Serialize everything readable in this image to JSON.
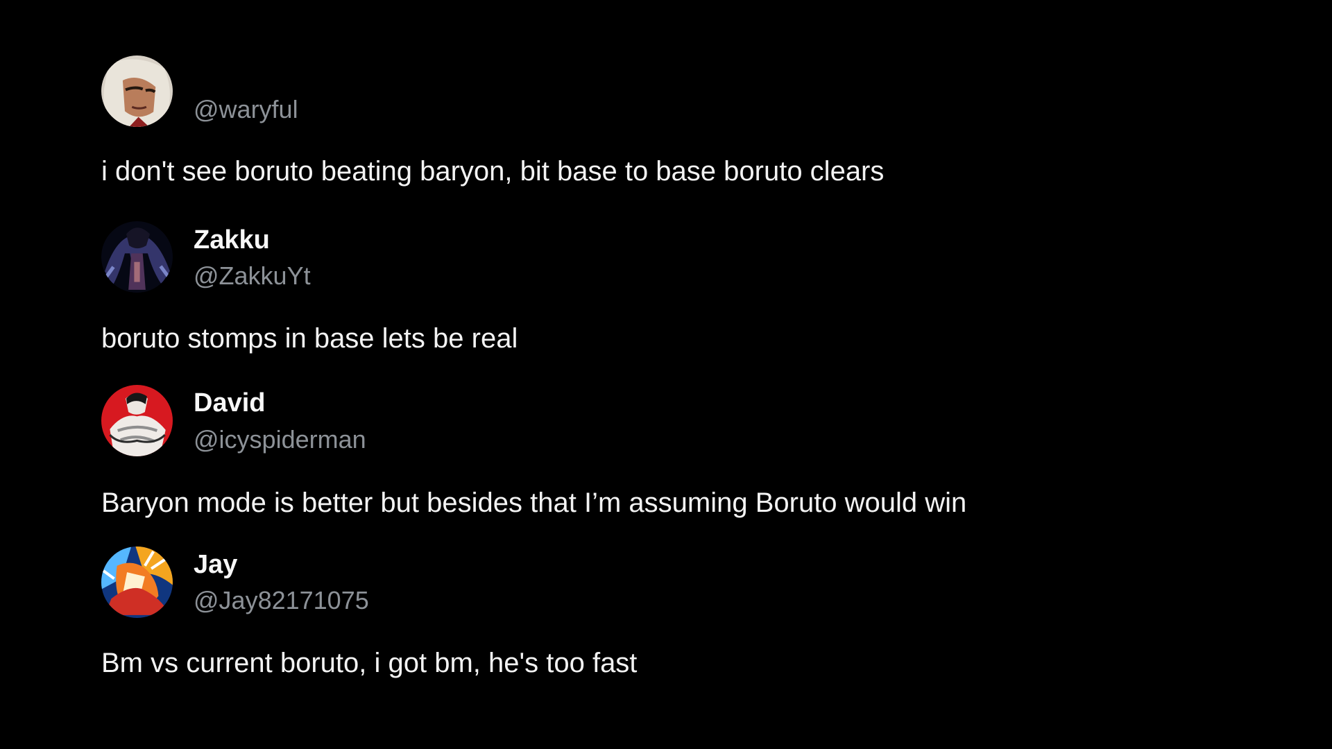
{
  "thread": {
    "posts": [
      {
        "display_name": "",
        "handle": "@waryful",
        "text": "i don't see boruto beating baryon, bit base to base boruto clears",
        "avatar_icon": "anime-character-avatar-icon"
      },
      {
        "display_name": "Zakku",
        "handle": "@ZakkuYt",
        "text": "boruto stomps in base lets be real",
        "avatar_icon": "dark-anime-character-avatar-icon"
      },
      {
        "display_name": "David",
        "handle": "@icyspiderman",
        "text": "Baryon mode is better but besides that I’m assuming Boruto would win",
        "avatar_icon": "muscular-character-red-background-avatar-icon"
      },
      {
        "display_name": "Jay",
        "handle": "@Jay82171075",
        "text": "Bm vs current boruto, i got bm, he's too fast",
        "avatar_icon": "colorful-fighting-character-avatar-icon"
      }
    ]
  },
  "colors": {
    "background": "#000000",
    "text": "#f3f3f3",
    "handle": "#8d9298",
    "red_avatar": "#d71920"
  }
}
